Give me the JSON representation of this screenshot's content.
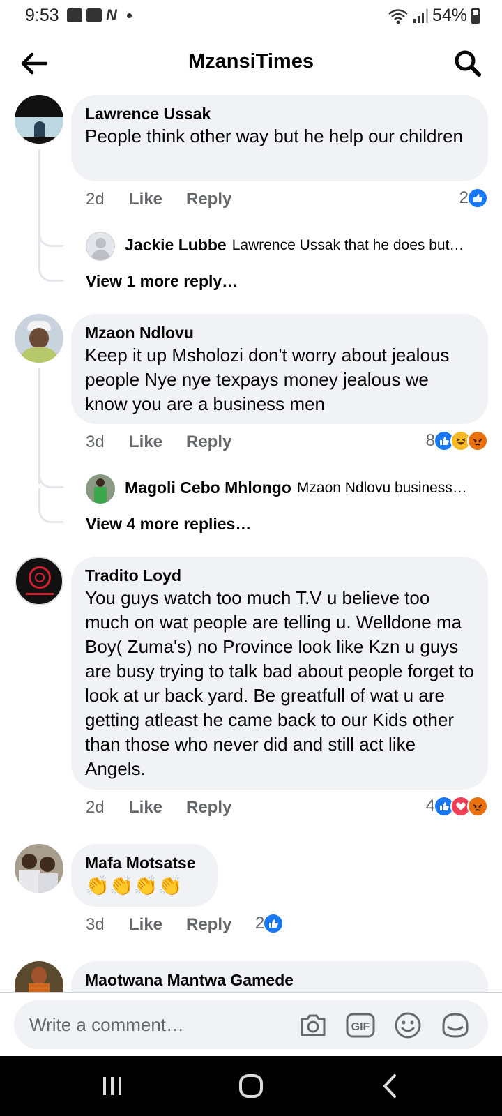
{
  "status_bar": {
    "time": "9:53",
    "battery": "54%"
  },
  "header": {
    "title": "MzansiTimes"
  },
  "comments": [
    {
      "author": "Lawrence Ussak",
      "text": "People think other way but he help our children",
      "time": "2d",
      "like": "Like",
      "reply": "Reply",
      "reaction_count": "2",
      "reply_preview": {
        "author": "Jackie Lubbe",
        "text": "Lawrence Ussak that he does but…"
      },
      "view_more": "View 1 more reply…"
    },
    {
      "author": "Mzaon Ndlovu",
      "text": "Keep it up Msholozi don't worry about jealous people Nye nye texpays money jealous we know you are a business men",
      "time": "3d",
      "like": "Like",
      "reply": "Reply",
      "reaction_count": "8",
      "reply_preview": {
        "author": "Magoli Cebo Mhlongo",
        "text": "Mzaon Ndlovu business…"
      },
      "view_more": "View 4 more replies…"
    },
    {
      "author": "Tradito Loyd",
      "text": "You guys watch too much T.V u believe too much on wat people are telling u. Welldone ma Boy( Zuma's) no Province look like Kzn u guys are busy trying to talk bad about people forget to look at ur back yard.  Be greatfull of wat u are getting atleast he came back to our Kids other than those who never did and still act like Angels.",
      "time": "2d",
      "like": "Like",
      "reply": "Reply",
      "reaction_count": "4"
    },
    {
      "author": "Mafa Motsatse",
      "text": "👏👏👏👏",
      "time": "3d",
      "like": "Like",
      "reply": "Reply",
      "reaction_count": "2"
    },
    {
      "author": "Maotwana Mantwa Gamede"
    }
  ],
  "composer": {
    "placeholder": "Write a comment…"
  }
}
